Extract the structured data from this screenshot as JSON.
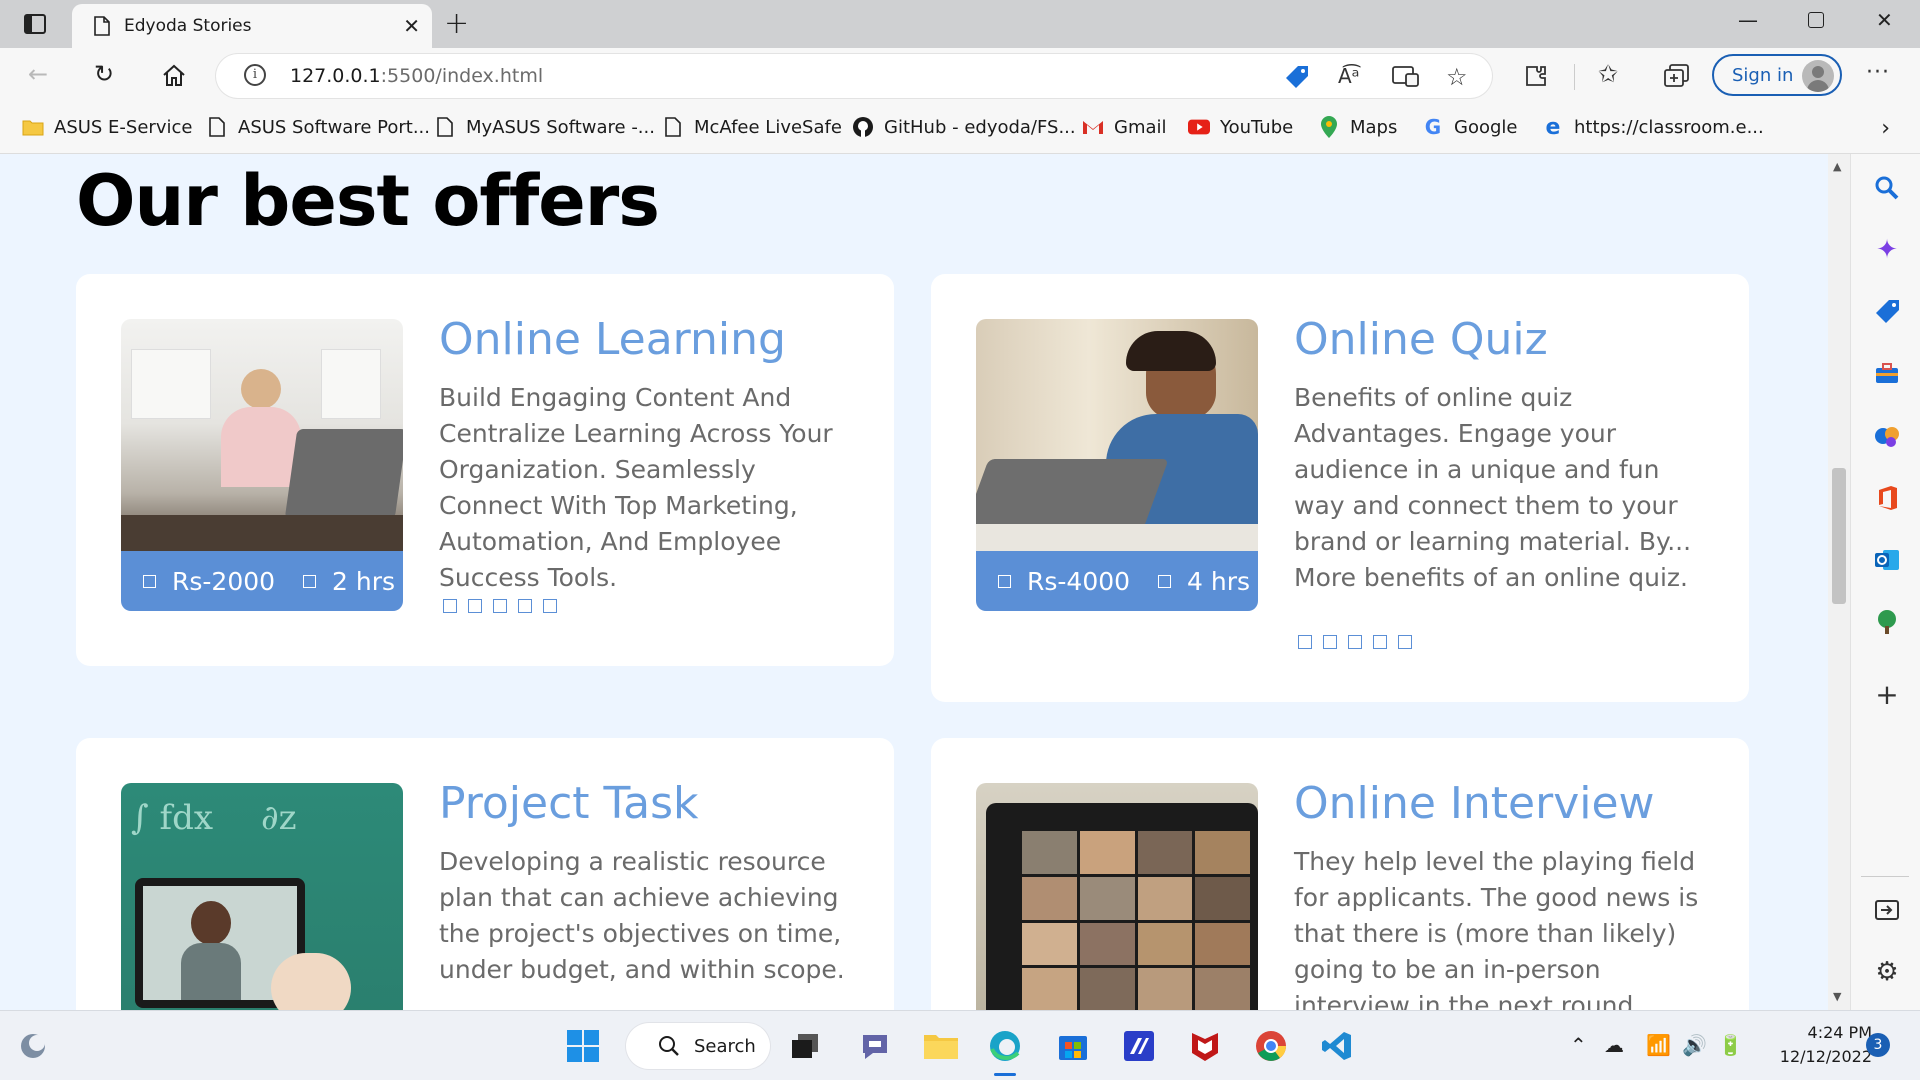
{
  "browser": {
    "tab_title": "Edyoda Stories",
    "url_host": "127.0.0.1",
    "url_rest": ":5500/index.html",
    "signin_label": "Sign in"
  },
  "bookmarks": [
    {
      "label": "ASUS E-Service",
      "icon": "folder-icon"
    },
    {
      "label": "ASUS Software Port...",
      "icon": "page-icon"
    },
    {
      "label": "MyASUS Software -...",
      "icon": "page-icon"
    },
    {
      "label": "McAfee LiveSafe",
      "icon": "page-icon"
    },
    {
      "label": "GitHub - edyoda/FS...",
      "icon": "github-icon"
    },
    {
      "label": "Gmail",
      "icon": "gmail-icon"
    },
    {
      "label": "YouTube",
      "icon": "youtube-icon"
    },
    {
      "label": "Maps",
      "icon": "maps-icon"
    },
    {
      "label": "Google",
      "icon": "google-icon"
    },
    {
      "label": "https://classroom.e...",
      "icon": "edge-e-icon"
    }
  ],
  "page": {
    "heading": "Our best offers",
    "cards": [
      {
        "title": "Online Learning",
        "description": "Build Engaging Content And Centralize Learning Across Your Organization. Seamlessly Connect With Top Marketing, Automation, And Employee Success Tools.",
        "price": "Rs-2000",
        "duration": "2 hrs",
        "stars": 5
      },
      {
        "title": "Online Quiz",
        "description": "Benefits of online quiz Advantages. Engage your audience in a unique and fun way and connect them to your brand or learning material. By... More benefits of an online quiz.",
        "price": "Rs-4000",
        "duration": "4 hrs",
        "stars": 5
      },
      {
        "title": "Project Task",
        "description": "Developing a realistic resource plan that can achieve achieving the project's objectives on time, under budget, and within scope."
      },
      {
        "title": "Online Interview",
        "description": "They help level the playing field for applicants. The good news is that there is (more than likely) going to be an in-person interview in the next round, giving"
      }
    ]
  },
  "taskbar": {
    "search_label": "Search",
    "time": "4:24 PM",
    "date": "12/12/2022",
    "notification_count": "3"
  },
  "colors": {
    "accent": "#5b8fd6",
    "title": "#6a9ede",
    "page_bg": "#edf5ff"
  }
}
